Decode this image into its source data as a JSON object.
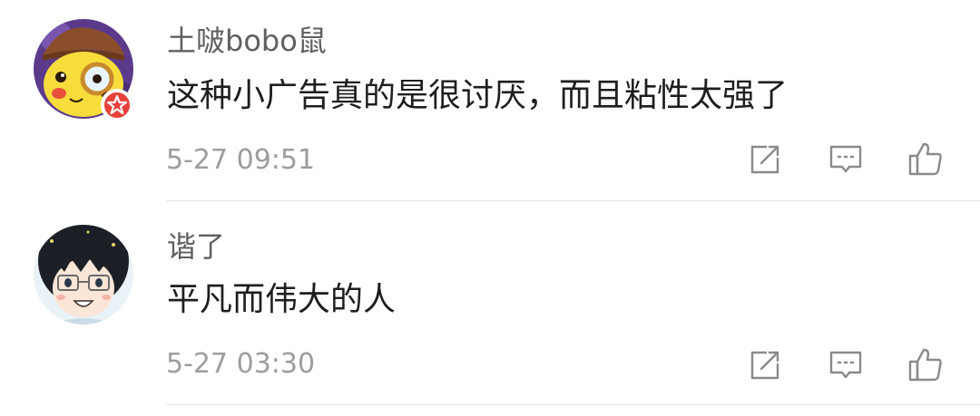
{
  "comments": [
    {
      "username": "土啵bobo鼠",
      "content": "这种小广告真的是很讨厌，而且粘性太强了",
      "time": "5-27 09:51",
      "avatar_icon": "pikachu-detective-avatar",
      "badge_icon": "verified-star-badge",
      "badge_color": "#e8403a"
    },
    {
      "username": "谐了",
      "content": "平凡而伟大的人",
      "time": "5-27 03:30",
      "avatar_icon": "anime-boy-glasses-avatar"
    }
  ],
  "actions": [
    "repost-icon",
    "reply-icon",
    "like-icon"
  ],
  "colors": {
    "username": "#5f5f5f",
    "content": "#1e1e1e",
    "time": "#9d9d9d",
    "icon": "#8a8a8a",
    "divider": "#e5e5e5"
  }
}
